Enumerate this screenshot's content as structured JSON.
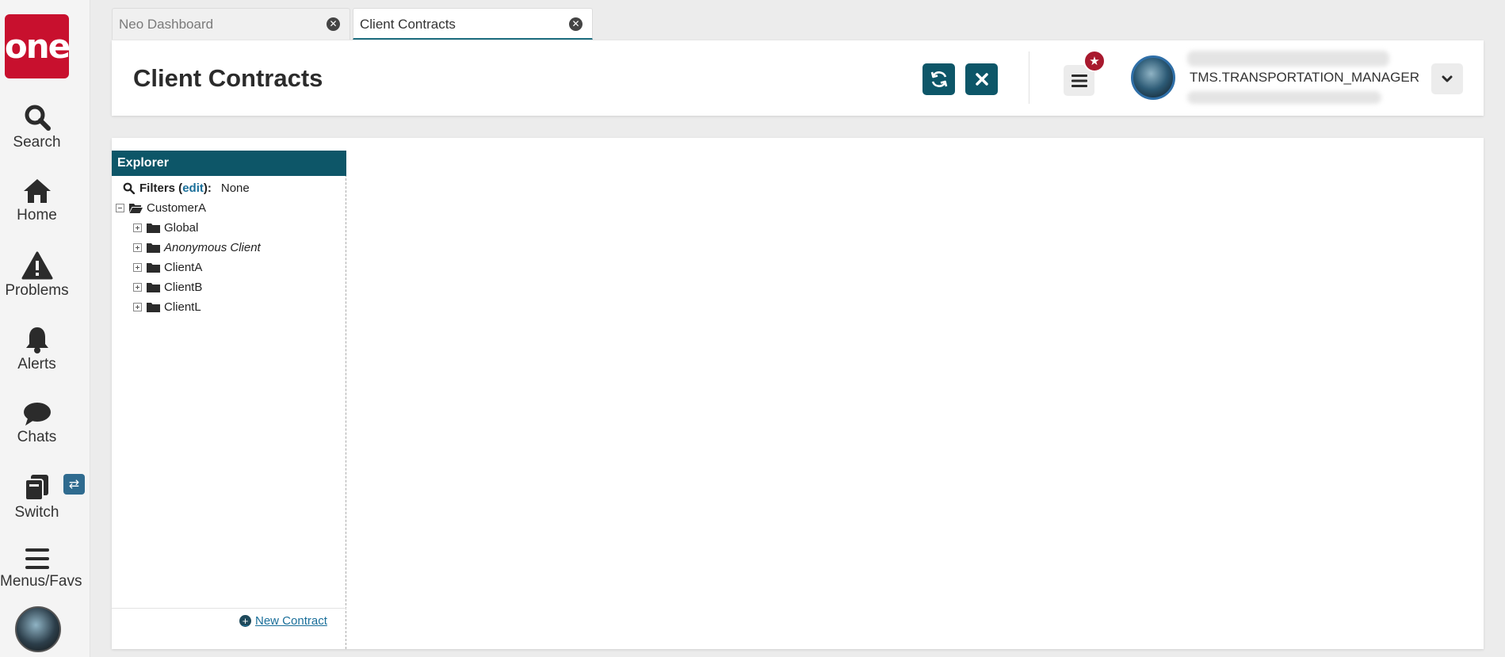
{
  "brand": {
    "logo_text": "one",
    "color": "#c8102e"
  },
  "nav": {
    "items": [
      {
        "label": "Search",
        "icon": "search-icon"
      },
      {
        "label": "Home",
        "icon": "home-icon"
      },
      {
        "label": "Problems",
        "icon": "warning-icon"
      },
      {
        "label": "Alerts",
        "icon": "bell-icon"
      },
      {
        "label": "Chats",
        "icon": "chat-icon"
      },
      {
        "label": "Switch",
        "icon": "switch-icon"
      },
      {
        "label": "Menus/Favs",
        "icon": "menu-icon"
      }
    ]
  },
  "tabs": [
    {
      "label": "Neo Dashboard",
      "active": false
    },
    {
      "label": "Client Contracts",
      "active": true
    }
  ],
  "header": {
    "title": "Client Contracts",
    "user_role": "TMS.TRANSPORTATION_MANAGER",
    "accent_color": "#0d5668"
  },
  "explorer": {
    "title": "Explorer",
    "filters_label": "Filters",
    "filters_edit": "edit",
    "filters_value": "None",
    "root": "CustomerA",
    "children": [
      "Global",
      "Anonymous Client",
      "ClientA",
      "ClientB",
      "ClientL"
    ],
    "new_contract": "New Contract"
  }
}
